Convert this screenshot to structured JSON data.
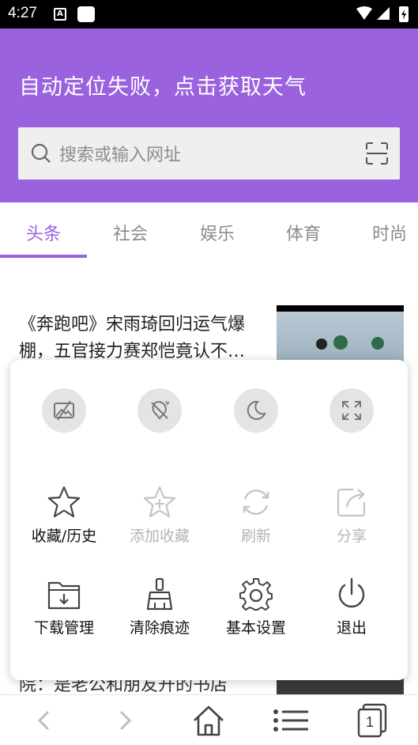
{
  "status_bar": {
    "time": "4:27",
    "notif_a": "A"
  },
  "header": {
    "weather_text": "自动定位失败，点击获取天气",
    "search_placeholder": "搜索或输入网址",
    "accent_color": "#9b62e0"
  },
  "tabs": [
    {
      "label": "头条",
      "active": true
    },
    {
      "label": "社会"
    },
    {
      "label": "娱乐"
    },
    {
      "label": "体育"
    },
    {
      "label": "时尚"
    }
  ],
  "news": [
    {
      "title": "《奔跑吧》宋雨琦回归运气爆棚，五官接力赛郑恺竟认不…"
    },
    {
      "title": "院：是老公和朋友开的书店"
    }
  ],
  "menu": {
    "quick_toggles": [
      {
        "icon": "no-image-icon"
      },
      {
        "icon": "no-ads-icon"
      },
      {
        "icon": "night-mode-icon"
      },
      {
        "icon": "fullscreen-icon"
      }
    ],
    "row1": [
      {
        "label": "收藏/历史",
        "icon": "star-icon",
        "enabled": true
      },
      {
        "label": "添加收藏",
        "icon": "star-plus-icon",
        "enabled": false
      },
      {
        "label": "刷新",
        "icon": "refresh-icon",
        "enabled": false
      },
      {
        "label": "分享",
        "icon": "share-icon",
        "enabled": false
      }
    ],
    "row2": [
      {
        "label": "下载管理",
        "icon": "download-folder-icon",
        "enabled": true
      },
      {
        "label": "清除痕迹",
        "icon": "broom-icon",
        "enabled": true
      },
      {
        "label": "基本设置",
        "icon": "gear-icon",
        "enabled": true
      },
      {
        "label": "退出",
        "icon": "power-icon",
        "enabled": true
      }
    ]
  },
  "bottom_nav": {
    "tab_count": "1"
  }
}
